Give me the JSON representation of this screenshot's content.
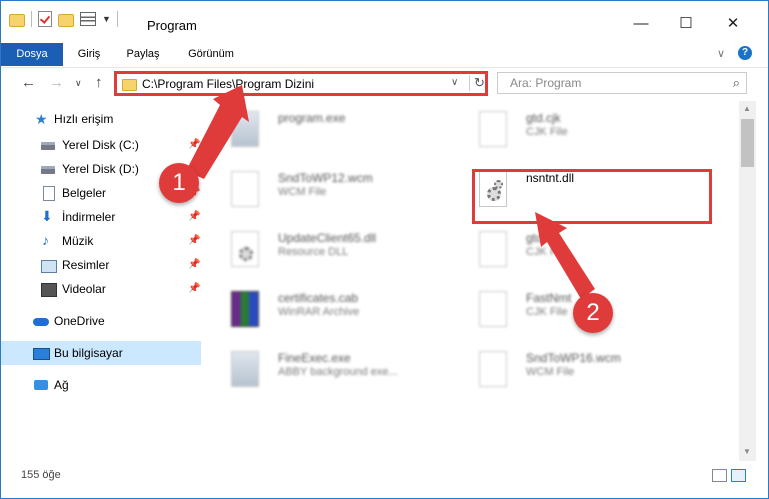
{
  "window": {
    "title": "Program",
    "minimize": "—",
    "maximize": "☐",
    "close": "✕"
  },
  "ribbon": {
    "tabs": [
      "Dosya",
      "Giriş",
      "Paylaş",
      "Görünüm"
    ],
    "expand": "∨",
    "help": "?"
  },
  "nav": {
    "back": "←",
    "forward": "→",
    "recent": "∨",
    "up": "↑",
    "address": "C:\\Program Files\\Program Dizini",
    "address_dropdown": "∨",
    "refresh": "↻",
    "search_placeholder": "Ara: Program",
    "search_icon": "⌕"
  },
  "sidebar": {
    "items": [
      {
        "label": "Hızlı erişim",
        "icon": "star-icon"
      },
      {
        "label": "Yerel Disk (C:)",
        "icon": "drive-icon",
        "pinned": true
      },
      {
        "label": "Yerel Disk (D:)",
        "icon": "drive-icon",
        "pinned": true
      },
      {
        "label": "Belgeler",
        "icon": "document-icon",
        "pinned": true
      },
      {
        "label": "İndirmeler",
        "icon": "download-icon",
        "pinned": true
      },
      {
        "label": "Müzik",
        "icon": "music-icon",
        "pinned": true
      },
      {
        "label": "Resimler",
        "icon": "pictures-icon",
        "pinned": true
      },
      {
        "label": "Videolar",
        "icon": "video-icon",
        "pinned": true
      },
      {
        "label": "OneDrive",
        "icon": "cloud-icon"
      },
      {
        "label": "Bu bilgisayar",
        "icon": "computer-icon",
        "selected": true
      },
      {
        "label": "Ağ",
        "icon": "network-icon"
      }
    ],
    "pin_glyph": "📌"
  },
  "files": [
    {
      "name": "program.exe",
      "type": "",
      "icon": "exe-icon"
    },
    {
      "name": "gtd.cjk",
      "type": "CJK File",
      "icon": "file-icon"
    },
    {
      "name": "SndToWP12.wcm",
      "type": "WCM File",
      "icon": "file-icon"
    },
    {
      "name": "nsntnt.dll",
      "type": "",
      "icon": "dll-gear-icon",
      "highlighted": true
    },
    {
      "name": "UpdateClient65.dll",
      "type": "Resource DLL",
      "icon": "dll-gear-icon"
    },
    {
      "name": "gtd.cjk",
      "type": "CJK File",
      "icon": "file-icon"
    },
    {
      "name": "certificates.cab",
      "type": "WinRAR Archive",
      "icon": "rar-icon"
    },
    {
      "name": "FastNmt",
      "type": "CJK File",
      "icon": "file-icon"
    },
    {
      "name": "FineExec.exe",
      "type": "ABBY background exe...",
      "icon": "exe-icon"
    },
    {
      "name": "SndToWP16.wcm",
      "type": "WCM File",
      "icon": "file-icon"
    }
  ],
  "status": {
    "item_count": "155 öğe"
  },
  "annotations": {
    "step1": "1",
    "step2": "2",
    "accent": "#e03b3b"
  }
}
